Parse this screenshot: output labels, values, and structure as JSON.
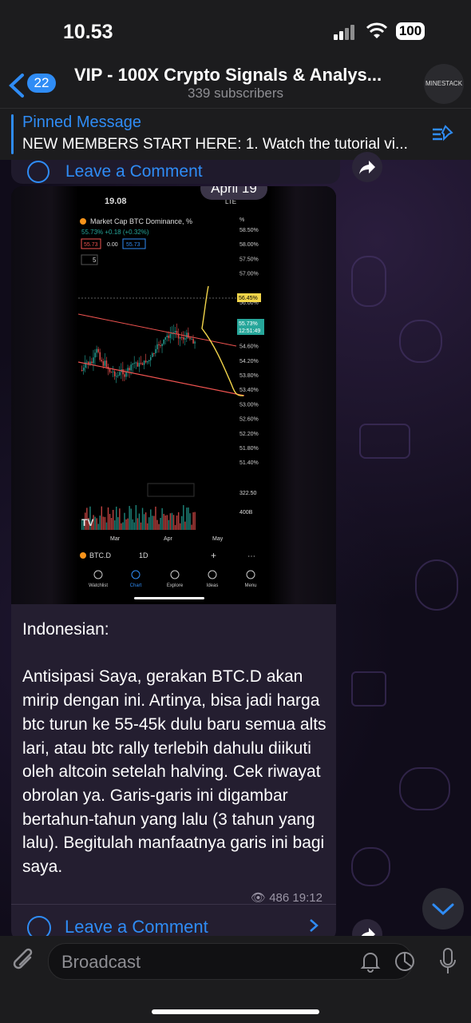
{
  "status": {
    "time": "10.53",
    "battery": "100"
  },
  "header": {
    "back_count": "22",
    "title": "VIP - 100X Crypto Signals & Analys...",
    "subscribers": "339 subscribers",
    "avatar_label": "MINESTACK"
  },
  "pinned": {
    "title": "Pinned Message",
    "text": "NEW MEMBERS START HERE: 1. Watch the tutorial vi..."
  },
  "prev_message": {
    "comment_label": "Leave a Comment"
  },
  "message": {
    "date": "April 19",
    "text": "Indonesian:\n\nAntisipasi Saya, gerakan BTC.D akan mirip dengan ini. Artinya, bisa jadi harga btc turun ke 55-45k dulu baru semua alts lari, atau btc rally terlebih dahulu diikuti oleh altcoin setelah halving. Cek riwayat obrolan ya. Garis-garis ini digambar bertahun-tahun yang lalu (3 tahun yang lalu). Begitulah manfaatnya garis ini bagi saya.",
    "views": "486",
    "time": "19:12",
    "comment_label": "Leave a Comment"
  },
  "screenshot": {
    "time": "19.08",
    "network": "LTE",
    "chart_title": "Market Cap BTC Dominance, %",
    "change": "55.73% +0.18 (+0.32%)",
    "bid": "55.73",
    "spread": "0.00",
    "ask": "55.73",
    "interval_btn": "5",
    "axis_unit": "%",
    "y_ticks": [
      "58.50%",
      "58.00%",
      "57.50%",
      "57.00%",
      "56.45%",
      "56.00%",
      "55.73%",
      "55.00%",
      "54.60%",
      "54.20%",
      "53.80%",
      "53.40%",
      "53.00%",
      "52.60%",
      "52.20%",
      "51.80%",
      "51.40%"
    ],
    "price_tag": "56.45%",
    "current_tag": "55.73%",
    "current_time": "12:51:49",
    "vol_ticks": [
      "322.50",
      "400B"
    ],
    "months": [
      "Mar",
      "Apr",
      "May"
    ],
    "logo": "TV",
    "symbol": "BTC.D",
    "timeframe": "1D",
    "nav": [
      "Watchlist",
      "Chart",
      "Explore",
      "Ideas",
      "Menu"
    ]
  },
  "chart_data": {
    "type": "candlestick",
    "title": "Market Cap BTC Dominance, %",
    "ylabel": "%",
    "ylim": [
      51.4,
      58.5
    ],
    "categories": [
      "Mar",
      "Apr",
      "May"
    ],
    "current_value": 55.73,
    "marked_level": 56.45
  },
  "footer": {
    "placeholder": "Broadcast"
  },
  "colors": {
    "accent": "#2f8cf5",
    "bubble": "#241e30",
    "up": "#26a69a",
    "down": "#ef5350",
    "annotation": "#f2d54a"
  }
}
